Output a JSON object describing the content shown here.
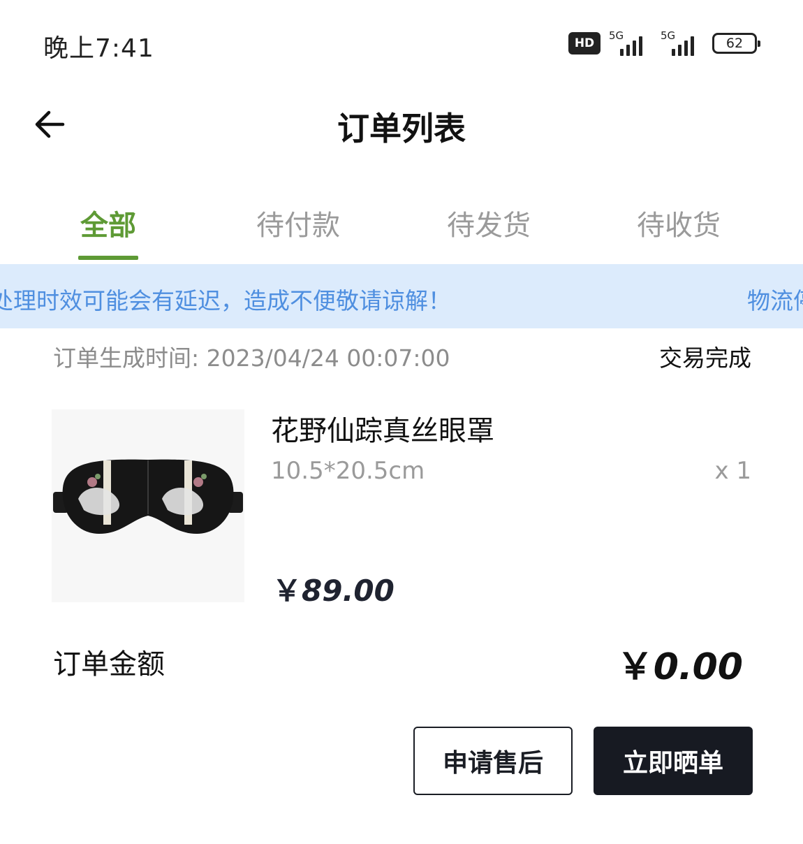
{
  "status_bar": {
    "time": "晚上7:41",
    "hd_label": "HD",
    "network_1": "5G",
    "network_2": "5G",
    "battery": "62"
  },
  "header": {
    "title": "订单列表"
  },
  "tabs": [
    {
      "label": "全部",
      "active": true
    },
    {
      "label": "待付款",
      "active": false
    },
    {
      "label": "待发货",
      "active": false
    },
    {
      "label": "待收货",
      "active": false
    }
  ],
  "notice": {
    "text": "处理时效可能会有延迟，造成不便敬请谅解！",
    "text_2": "物流停"
  },
  "order": {
    "created_label": "订单生成时间:",
    "created_time": "2023/04/24 00:07:00",
    "status": "交易完成",
    "product": {
      "name": "花野仙踪真丝眼罩",
      "spec": "10.5*20.5cm",
      "qty": "x 1",
      "currency": "￥",
      "price": "89.00"
    },
    "total_label": "订单金额",
    "total_currency": "￥",
    "total_value": "0.00",
    "actions": {
      "after_sale": "申请售后",
      "share": "立即晒单"
    }
  },
  "colors": {
    "accent_green": "#5e9a35",
    "notice_bg": "#dcebfc",
    "notice_text": "#4f8fe0",
    "dark_button": "#171a22"
  }
}
